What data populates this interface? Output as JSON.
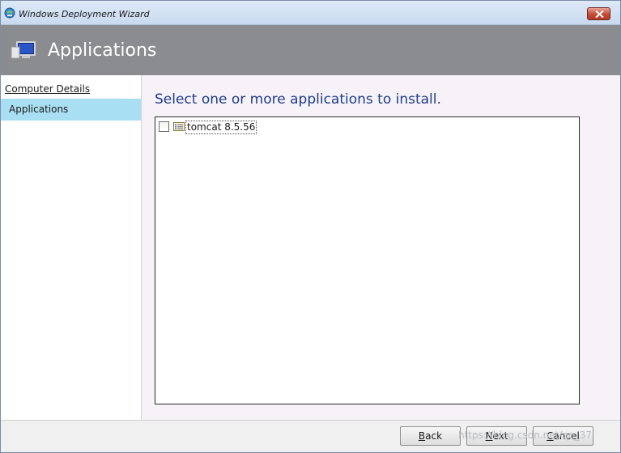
{
  "window": {
    "title": "Windows Deployment Wizard",
    "title_icon": "wizard-app-icon",
    "close_icon": "close-icon"
  },
  "header": {
    "title": "Applications",
    "icon": "computer-monitor-icon",
    "background": "#8a8c8f"
  },
  "sidebar": {
    "items": [
      {
        "label": "Computer Details",
        "active": false
      },
      {
        "label": "Applications",
        "active": true
      }
    ],
    "active_color": "#a9dff2"
  },
  "main": {
    "prompt": "Select one or more applications to install.",
    "prompt_color": "#1f3c8c",
    "applications": [
      {
        "label": "tomcat 8.5.56",
        "checked": false,
        "icon": "application-list-icon"
      }
    ]
  },
  "footer": {
    "back": {
      "pre": "",
      "key": "B",
      "post": "ack"
    },
    "next": {
      "pre": "",
      "key": "N",
      "post": "ext"
    },
    "cancel": {
      "pre": "",
      "key": "C",
      "post": "ancel"
    }
  },
  "watermark": "https://blog.csdn.net/qq_37"
}
